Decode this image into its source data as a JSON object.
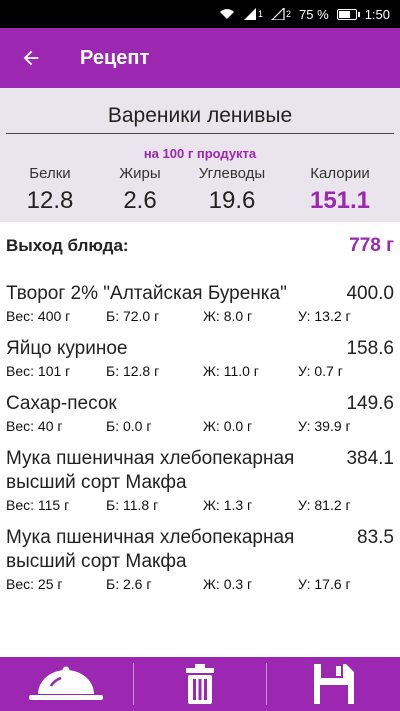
{
  "status": {
    "sim1": "1",
    "sim2": "2",
    "battery_pct": "75 %",
    "time": "1:50",
    "battery_level": 0.75
  },
  "app_bar": {
    "title": "Рецепт"
  },
  "recipe": {
    "name": "Вареники ленивые",
    "per100_label": "на 100 г продукта",
    "nutrients": [
      {
        "label": "Белки",
        "value": "12.8"
      },
      {
        "label": "Жиры",
        "value": "2.6"
      },
      {
        "label": "Углеводы",
        "value": "19.6"
      },
      {
        "label": "Калории",
        "value": "151.1"
      }
    ],
    "yield_label": "Выход блюда:",
    "yield_value": "778 г"
  },
  "ingredients": [
    {
      "name": "Творог 2% \"Алтайская Буренка\"",
      "cal": "400.0",
      "weight": "Вес: 400 г",
      "protein": "Б: 72.0 г",
      "fat": "Ж: 8.0 г",
      "carbs": "У: 13.2 г"
    },
    {
      "name": "Яйцо куриное",
      "cal": "158.6",
      "weight": "Вес: 101 г",
      "protein": "Б: 12.8 г",
      "fat": "Ж: 11.0 г",
      "carbs": "У: 0.7 г"
    },
    {
      "name": "Сахар-песок",
      "cal": "149.6",
      "weight": "Вес: 40 г",
      "protein": "Б: 0.0 г",
      "fat": "Ж: 0.0 г",
      "carbs": "У: 39.9 г"
    },
    {
      "name": "Мука пшеничная хлебопекарная высший сорт Макфа",
      "cal": "384.1",
      "weight": "Вес: 115 г",
      "protein": "Б: 11.8 г",
      "fat": "Ж: 1.3 г",
      "carbs": "У: 81.2 г"
    },
    {
      "name": "Мука пшеничная хлебопекарная высший сорт Макфа",
      "cal": "83.5",
      "weight": "Вес: 25 г",
      "protein": "Б: 2.6 г",
      "fat": "Ж: 0.3 г",
      "carbs": "У: 17.6 г"
    }
  ],
  "bottom_bar": {
    "icons": [
      "serving-cloche-icon",
      "trash-icon",
      "floppy-disk-icon"
    ]
  },
  "colors": {
    "accent": "#9c27b0",
    "summary_bg": "#eae4ec"
  }
}
